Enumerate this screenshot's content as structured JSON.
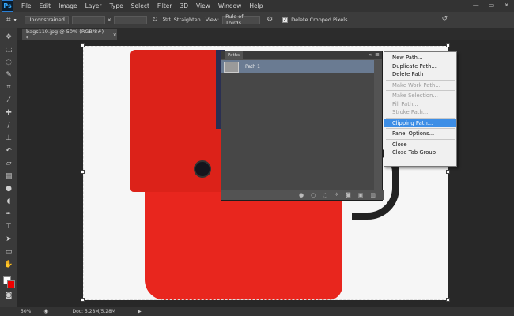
{
  "app": {
    "logo": "Ps"
  },
  "menubar": {
    "items": [
      "File",
      "Edit",
      "Image",
      "Layer",
      "Type",
      "Select",
      "Filter",
      "3D",
      "View",
      "Window",
      "Help"
    ]
  },
  "optionsbar": {
    "ratio": "Unconstrained",
    "swap": "⇄",
    "times": "×",
    "rotate_hint": "Strt",
    "straighten": "Straighten",
    "view_label": "View:",
    "view_value": "Rule of Thirds",
    "delete_label": "Delete Cropped Pixels"
  },
  "document": {
    "tab_title": "bags119.jpg @ 50% (RGB/8#) *",
    "close": "×"
  },
  "paths_panel": {
    "title": "Paths",
    "path_name": "Path 1"
  },
  "context_menu": {
    "items": [
      {
        "label": "New Path...",
        "disabled": false
      },
      {
        "label": "Duplicate Path...",
        "disabled": false
      },
      {
        "label": "Delete Path",
        "disabled": false
      },
      {
        "label": "Make Work Path...",
        "disabled": true
      },
      {
        "label": "Make Selection...",
        "disabled": true
      },
      {
        "label": "Fill Path...",
        "disabled": true
      },
      {
        "label": "Stroke Path...",
        "disabled": true
      },
      {
        "label": "Clipping Path...",
        "disabled": false,
        "highlighted": true
      },
      {
        "label": "Panel Options...",
        "disabled": false
      },
      {
        "label": "Close",
        "disabled": false
      },
      {
        "label": "Close Tab Group",
        "disabled": false
      }
    ]
  },
  "statusbar": {
    "zoom": "50%",
    "doc": "Doc: 5.28M/5.28M"
  },
  "colors": {
    "highlight": "#3d8ee6",
    "bag": "#e8261e"
  }
}
